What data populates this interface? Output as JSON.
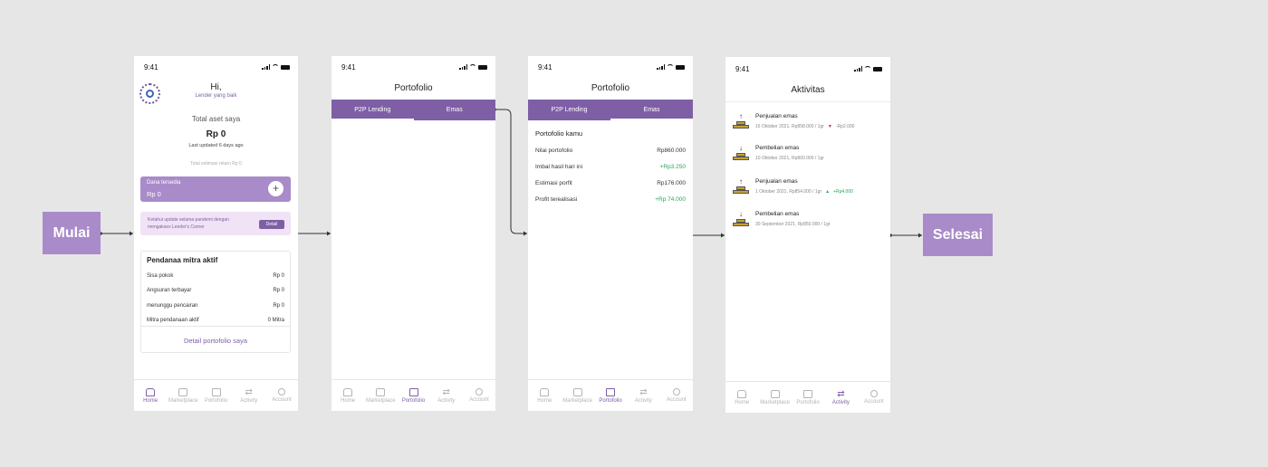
{
  "terminals": {
    "start": "Mulai",
    "end": "Selesai"
  },
  "status_time": "9:41",
  "nav": [
    "Home",
    "Marketplace",
    "Portofolio",
    "Activity",
    "Account"
  ],
  "screen1": {
    "greeting": "Hi,",
    "subtitle": "Lender yang baik",
    "total_label": "Total aset saya",
    "total_value": "Rp 0",
    "last_updated": "Last updated 6 days ago",
    "total_return": "Total estimasi return Rp 0",
    "dana_label": "Dana tersedia",
    "dana_value": "Rp 0",
    "plus": "+",
    "notice_text": "Ketahui update selama pandemi dengan mengakses Lender's Corner",
    "notice_button": "Detail",
    "mitra_title": "Pendanaa mitra aktif",
    "mitra_rows": [
      {
        "label": "Sisa pokok",
        "value": "Rp 0"
      },
      {
        "label": "Angsuran terbayar",
        "value": "Rp 0"
      },
      {
        "label": "menunggu pencairan",
        "value": "Rp 0"
      },
      {
        "label": "Mitra pendanaan aktif",
        "value": "0 Mitra"
      }
    ],
    "mitra_link": "Detail portofolio saya"
  },
  "screen2": {
    "title": "Portofolio",
    "tabs": [
      "P2P Lending",
      "Emas"
    ]
  },
  "screen3": {
    "title": "Portofolio",
    "tabs": [
      "P2P Lending",
      "Emas"
    ],
    "section": "Portofolio kamu",
    "rows": [
      {
        "label": "Nilai portofolio",
        "value": "Rp860.000"
      },
      {
        "label": "Imbal hasil hari ini",
        "value": "+Rp3.250"
      },
      {
        "label": "Estimasi porfit",
        "value": "Rp176.000"
      },
      {
        "label": "Profit terealisasi",
        "value": "+Rp 74.000"
      }
    ]
  },
  "screen4": {
    "title": "Aktivitas",
    "items": [
      {
        "title": "Penjualan emas",
        "detail": "16 Oktober 2021, Rp858.000 / 1gr",
        "change": "-Rp2.000"
      },
      {
        "title": "Pembelian emas",
        "detail": "10 Oktober 2021, Rp860.000 / 1gr",
        "change": ""
      },
      {
        "title": "Penjualan emas",
        "detail": "1 Oktober 2021, Rp854.000 / 1gr",
        "change": "+Rp4.000"
      },
      {
        "title": "Pembelian emas",
        "detail": "30 September 2021, Rp850.000 / 1gr",
        "change": ""
      }
    ]
  },
  "colors": {
    "background": "#e6e6e6",
    "primary": "#7e5fa6",
    "light_primary": "#a98bc9",
    "positive": "#27a35b",
    "negative": "#c3262f"
  }
}
